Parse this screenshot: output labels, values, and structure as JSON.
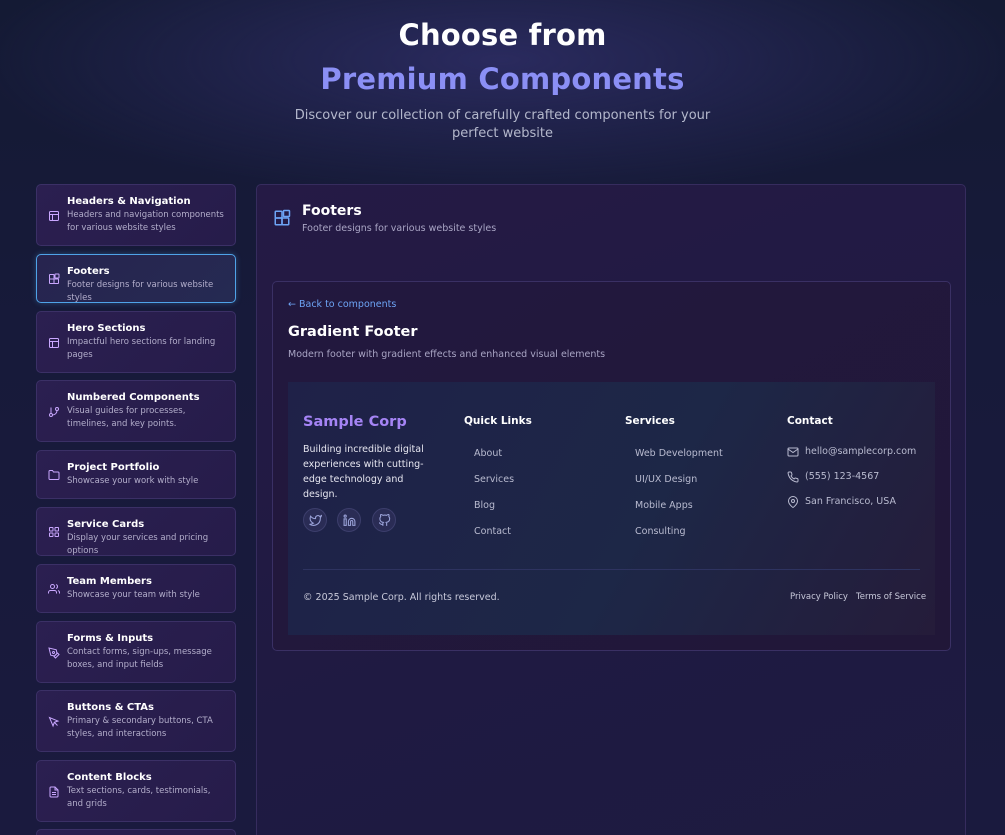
{
  "hero": {
    "title_line1": "Choose from",
    "title_line2": "Premium Components",
    "subtitle": "Discover our collection of carefully crafted components for your perfect website"
  },
  "sidebar": {
    "items": [
      {
        "title": "Headers & Navigation",
        "desc": "Headers and navigation components for various website styles",
        "icon": "layout-icon",
        "active": false
      },
      {
        "title": "Footers",
        "desc": "Footer designs for various website styles",
        "icon": "blocks-icon",
        "active": true
      },
      {
        "title": "Hero Sections",
        "desc": "Impactful hero sections for landing pages",
        "icon": "layout-icon",
        "active": false
      },
      {
        "title": "Numbered Components",
        "desc": "Visual guides for processes, timelines, and key points.",
        "icon": "git-branch-icon",
        "active": false
      },
      {
        "title": "Project Portfolio",
        "desc": "Showcase your work with style",
        "icon": "folder-icon",
        "active": false
      },
      {
        "title": "Service Cards",
        "desc": "Display your services and pricing options",
        "icon": "grid-icon",
        "active": false
      },
      {
        "title": "Team Members",
        "desc": "Showcase your team with style",
        "icon": "users-icon",
        "active": false
      },
      {
        "title": "Forms & Inputs",
        "desc": "Contact forms, sign-ups, message boxes, and input fields",
        "icon": "pen-tool-icon",
        "active": false
      },
      {
        "title": "Buttons & CTAs",
        "desc": "Primary & secondary buttons, CTA styles, and interactions",
        "icon": "cursor-icon",
        "active": false
      },
      {
        "title": "Content Blocks",
        "desc": "Text sections, cards, testimonials, and grids",
        "icon": "file-text-icon",
        "active": false
      }
    ]
  },
  "main": {
    "title": "Footers",
    "subtitle": "Footer designs for various website styles",
    "card": {
      "back_label": "← Back to components",
      "title": "Gradient Footer",
      "subtitle": "Modern footer with gradient effects and enhanced visual elements"
    }
  },
  "footer_preview": {
    "brand": "Sample Corp",
    "tagline": "Building incredible digital experiences with cutting-edge technology and design.",
    "social": [
      "twitter-icon",
      "linkedin-icon",
      "github-icon"
    ],
    "quick_links": {
      "heading": "Quick Links",
      "items": [
        "About",
        "Services",
        "Blog",
        "Contact"
      ]
    },
    "services": {
      "heading": "Services",
      "items": [
        "Web Development",
        "UI/UX Design",
        "Mobile Apps",
        "Consulting"
      ]
    },
    "contact": {
      "heading": "Contact",
      "email": "hello@samplecorp.com",
      "phone": "(555) 123-4567",
      "location": "San Francisco, USA"
    },
    "copyright": "© 2025 Sample Corp. All rights reserved.",
    "privacy": "Privacy Policy",
    "terms": "Terms of Service"
  },
  "colors": {
    "accent_purple": "#8b8ff5",
    "brand": "#a584f5",
    "active_border": "#4fa3e8",
    "link_blue": "#6da4f5"
  }
}
